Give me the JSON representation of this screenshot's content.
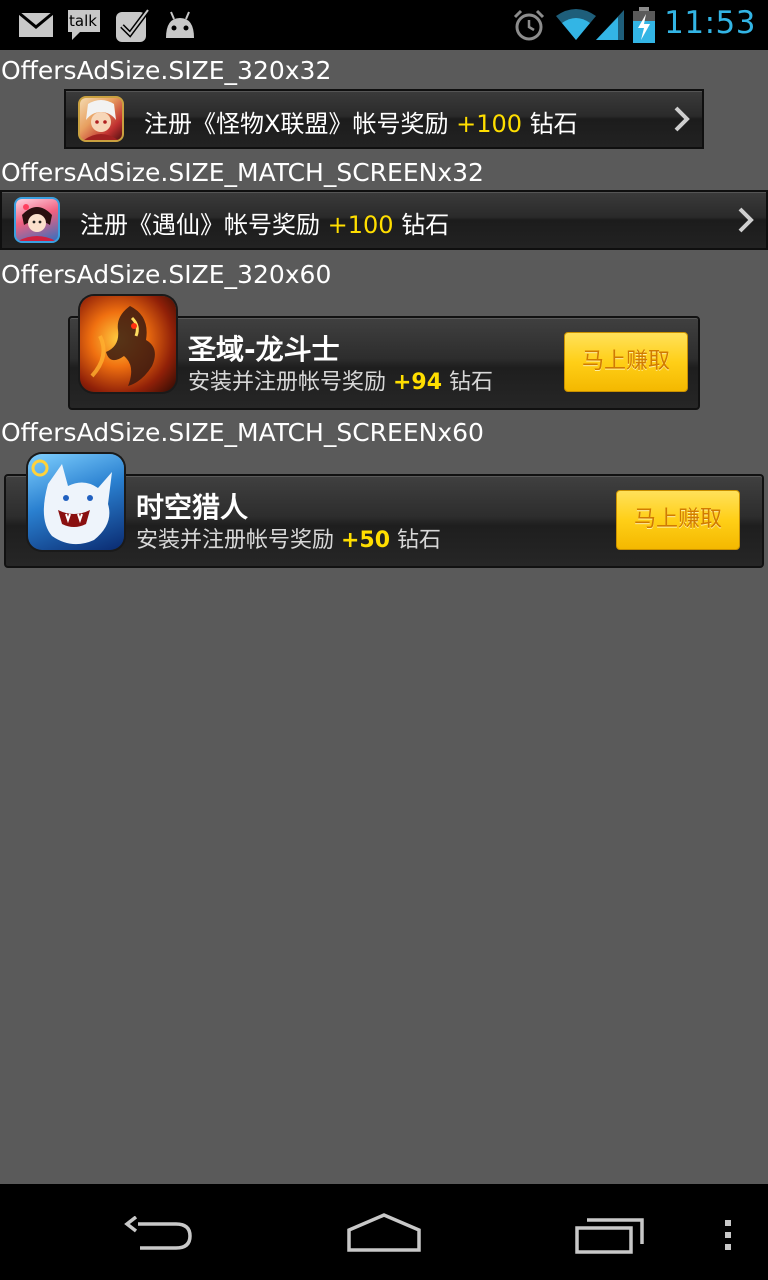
{
  "status_bar": {
    "time": "11:53",
    "icons": [
      "gmail-icon",
      "talk-icon",
      "tasks-check-icon",
      "android-icon",
      "alarm-icon",
      "wifi-icon",
      "signal-icon",
      "battery-charging-icon"
    ],
    "talk_text": "talk"
  },
  "sections": [
    {
      "label": "OffersAdSize.SIZE_320x32",
      "ad": {
        "icon": "monster-x-league-app-icon",
        "text_prefix": "注册《怪物X联盟》帐号奖励 ",
        "reward": "+100",
        "text_suffix": " 钻石"
      }
    },
    {
      "label": "OffersAdSize.SIZE_MATCH_SCREENx32",
      "ad": {
        "icon": "yuxian-app-icon",
        "text_prefix": "注册《遇仙》帐号奖励 ",
        "reward": "+100",
        "text_suffix": " 钻石"
      }
    },
    {
      "label": "OffersAdSize.SIZE_320x60",
      "ad": {
        "icon": "dragon-warrior-app-icon",
        "title": "圣域-龙斗士",
        "desc_prefix": "安装并注册帐号奖励 ",
        "reward": "+94",
        "desc_suffix": " 钻石",
        "button": "马上赚取"
      }
    },
    {
      "label": "OffersAdSize.SIZE_MATCH_SCREENx60",
      "ad": {
        "icon": "time-hunter-app-icon",
        "title": "时空猎人",
        "desc_prefix": "安装并注册帐号奖励 ",
        "reward": "+50",
        "desc_suffix": " 钻石",
        "button": "马上赚取"
      }
    }
  ],
  "colors": {
    "background": "#5a5a5a",
    "clock": "#33b5e5",
    "reward_highlight": "#ffde00",
    "earn_button": "#ffcf17"
  },
  "nav_bar": [
    "back-icon",
    "home-icon",
    "recent-apps-icon",
    "overflow-menu-icon"
  ]
}
